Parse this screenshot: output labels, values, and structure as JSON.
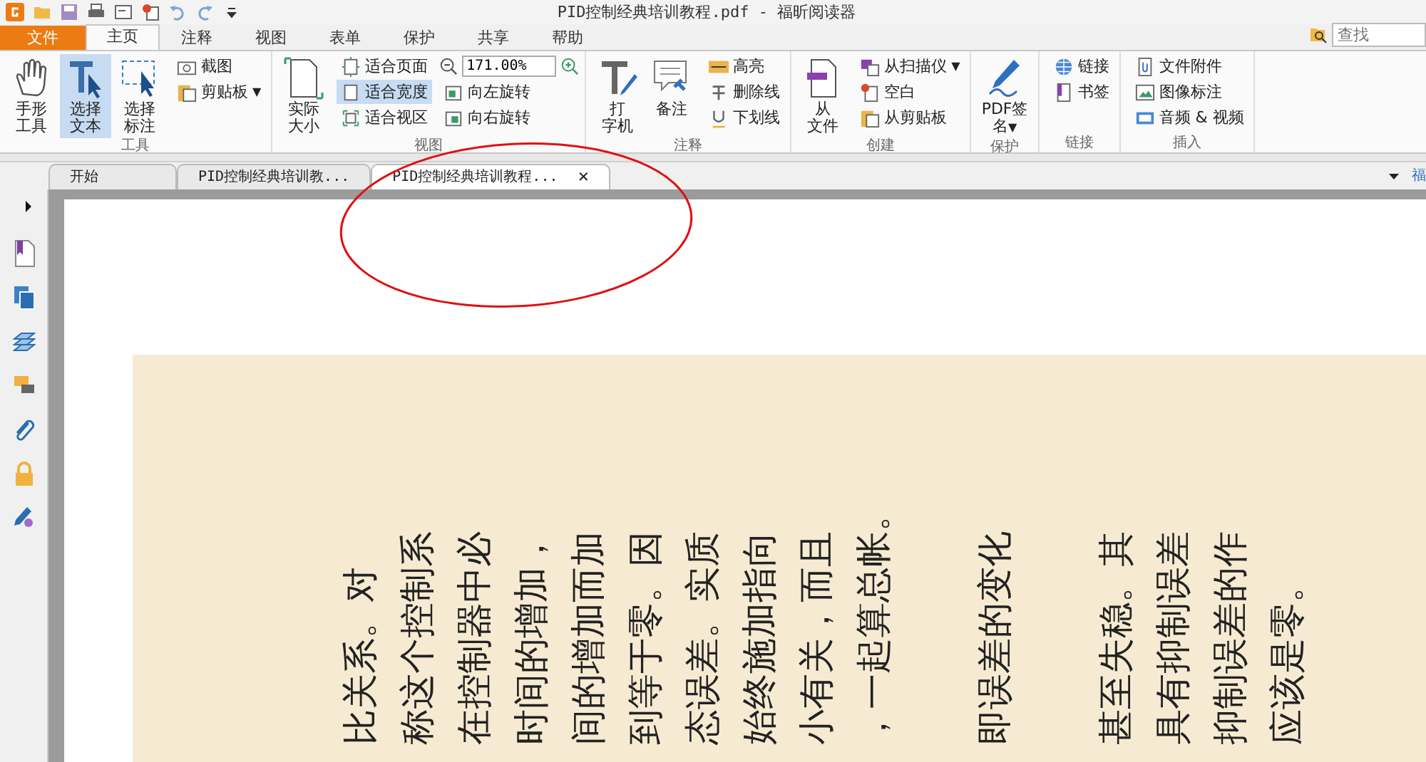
{
  "window": {
    "title": "PID控制经典培训教程.pdf - 福昕阅读器"
  },
  "search": {
    "placeholder": "查找"
  },
  "menu_tabs": [
    {
      "label": "文件",
      "kind": "file",
      "selected": false
    },
    {
      "label": "主页",
      "kind": "tab",
      "selected": true
    },
    {
      "label": "注释",
      "kind": "tab",
      "selected": false
    },
    {
      "label": "视图",
      "kind": "tab",
      "selected": false
    },
    {
      "label": "表单",
      "kind": "tab",
      "selected": false
    },
    {
      "label": "保护",
      "kind": "tab",
      "selected": false
    },
    {
      "label": "共享",
      "kind": "tab",
      "selected": false
    },
    {
      "label": "帮助",
      "kind": "tab",
      "selected": false
    }
  ],
  "ribbon": {
    "groups": [
      {
        "label": "工具",
        "columns": [
          {
            "kind": "large",
            "items": [
              {
                "lines": [
                  "手形",
                  "工具"
                ],
                "selected": false
              }
            ]
          },
          {
            "kind": "large",
            "items": [
              {
                "lines": [
                  "选择",
                  "文本"
                ],
                "selected": true
              }
            ]
          },
          {
            "kind": "large",
            "items": [
              {
                "lines": [
                  "选择",
                  "标注"
                ],
                "selected": false
              }
            ]
          },
          {
            "kind": "stack",
            "items": [
              {
                "label": "截图",
                "selected": false
              },
              {
                "label": "剪贴板",
                "selected": false,
                "caret": "▼"
              }
            ]
          }
        ]
      },
      {
        "label": "视图",
        "columns": [
          {
            "kind": "large",
            "items": [
              {
                "lines": [
                  "实际",
                  "大小"
                ],
                "selected": false
              }
            ]
          },
          {
            "kind": "stack",
            "items": [
              {
                "label": "适合页面",
                "selected": false
              },
              {
                "label": "适合宽度",
                "selected": true
              },
              {
                "label": "适合视区",
                "selected": false
              }
            ]
          },
          {
            "kind": "stack",
            "items": [
              {
                "kind": "zoom",
                "value": "171.00%"
              },
              {
                "label": "向左旋转",
                "selected": false
              },
              {
                "label": "向右旋转",
                "selected": false
              }
            ]
          }
        ]
      },
      {
        "label": "注释",
        "columns": [
          {
            "kind": "large",
            "items": [
              {
                "lines": [
                  "打",
                  "字机"
                ],
                "selected": false
              }
            ]
          },
          {
            "kind": "large",
            "items": [
              {
                "lines": [
                  "备注"
                ],
                "selected": false
              }
            ]
          },
          {
            "kind": "stack",
            "items": [
              {
                "label": "高亮",
                "selected": false
              },
              {
                "label": "删除线",
                "selected": false
              },
              {
                "label": "下划线",
                "selected": false
              }
            ]
          }
        ]
      },
      {
        "label": "创建",
        "columns": [
          {
            "kind": "large",
            "items": [
              {
                "lines": [
                  "从",
                  "文件"
                ],
                "selected": false
              }
            ]
          },
          {
            "kind": "stack",
            "items": [
              {
                "label": "从扫描仪",
                "selected": false,
                "caret": "▼"
              },
              {
                "label": "空白",
                "selected": false
              },
              {
                "label": "从剪贴板",
                "selected": false
              }
            ]
          }
        ]
      },
      {
        "label": "保护",
        "columns": [
          {
            "kind": "large",
            "items": [
              {
                "lines": [
                  "PDF签",
                  "名"
                ],
                "selected": false,
                "caret": "▼"
              }
            ]
          }
        ]
      },
      {
        "label": "链接",
        "columns": [
          {
            "kind": "stack",
            "items": [
              {
                "label": "链接",
                "selected": false
              },
              {
                "label": "书签",
                "selected": false
              }
            ]
          }
        ]
      },
      {
        "label": "插入",
        "columns": [
          {
            "kind": "stack",
            "items": [
              {
                "label": "文件附件",
                "selected": false
              },
              {
                "label": "图像标注",
                "selected": false
              },
              {
                "label": "音频 & 视频",
                "selected": false
              }
            ]
          }
        ]
      }
    ]
  },
  "doc_tabs": [
    {
      "label": "开始",
      "selected": false
    },
    {
      "label": "PID控制经典培训教...",
      "selected": false
    },
    {
      "label": "PID控制经典培训教程...",
      "selected": true,
      "close": "×"
    }
  ],
  "doc_tabs_overflow": "福",
  "document": {
    "paragraphs": [
      {
        "lines": [
          "比关系。对",
          "称这个控制系",
          "在控制器中必",
          "时间的增加，",
          "间的增加而加",
          "到等于零。因",
          "态误差。实质",
          "始终施加指向",
          "小有关，而且",
          "，一起算总帐。"
        ]
      },
      {
        "lines": [
          "即误差的变化"
        ]
      },
      {
        "lines": [
          "甚至失稳。其",
          "具有抑制误差",
          "抑制误差的作",
          "应该是零。"
        ]
      }
    ]
  }
}
